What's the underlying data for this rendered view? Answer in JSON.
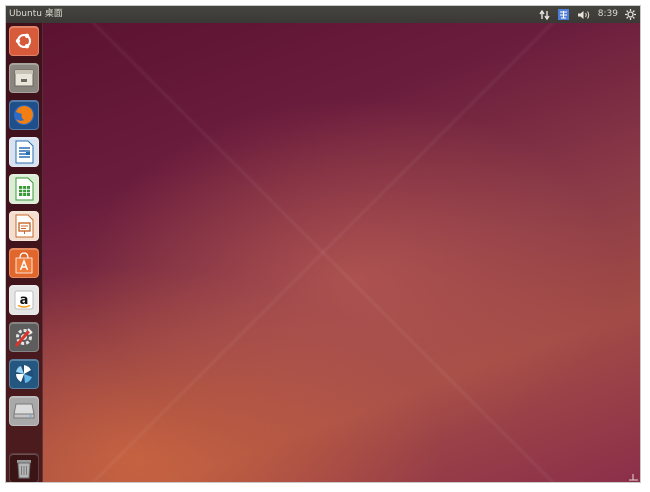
{
  "top_panel": {
    "title": "Ubuntu 桌面",
    "clock": "8:39",
    "indicators": [
      "network-icon",
      "input-method-icon",
      "volume-icon",
      "gear-icon"
    ]
  },
  "launcher": {
    "items": [
      {
        "name": "dash-home",
        "icon": "ubuntu-logo-icon",
        "color": "#e1704a"
      },
      {
        "name": "files",
        "icon": "file-cabinet-icon",
        "color": "#7d7a73"
      },
      {
        "name": "firefox",
        "icon": "firefox-icon",
        "color": "#e66000"
      },
      {
        "name": "libreoffice-writer",
        "icon": "writer-document-icon",
        "color": "#2a6fb3"
      },
      {
        "name": "libreoffice-calc",
        "icon": "calc-spreadsheet-icon",
        "color": "#3a9a3a"
      },
      {
        "name": "libreoffice-impress",
        "icon": "impress-presentation-icon",
        "color": "#c9682a"
      },
      {
        "name": "software-center",
        "icon": "shopping-bag-icon",
        "color": "#e0662c"
      },
      {
        "name": "amazon",
        "icon": "amazon-icon",
        "color": "#ececec"
      },
      {
        "name": "system-settings",
        "icon": "settings-wrench-icon",
        "color": "#6a6a6a"
      },
      {
        "name": "shotwell",
        "icon": "shotwell-icon",
        "color": "#2f6f9a"
      },
      {
        "name": "drive",
        "icon": "hard-drive-icon",
        "color": "#9a9a9a"
      },
      {
        "name": "trash",
        "icon": "trash-icon",
        "color": "#3b1416"
      }
    ]
  },
  "colors": {
    "panel": "#3c3b37",
    "launcher": "#3a1216",
    "wallpaper_dark": "#5b1130",
    "wallpaper_light": "#e07a3c"
  }
}
